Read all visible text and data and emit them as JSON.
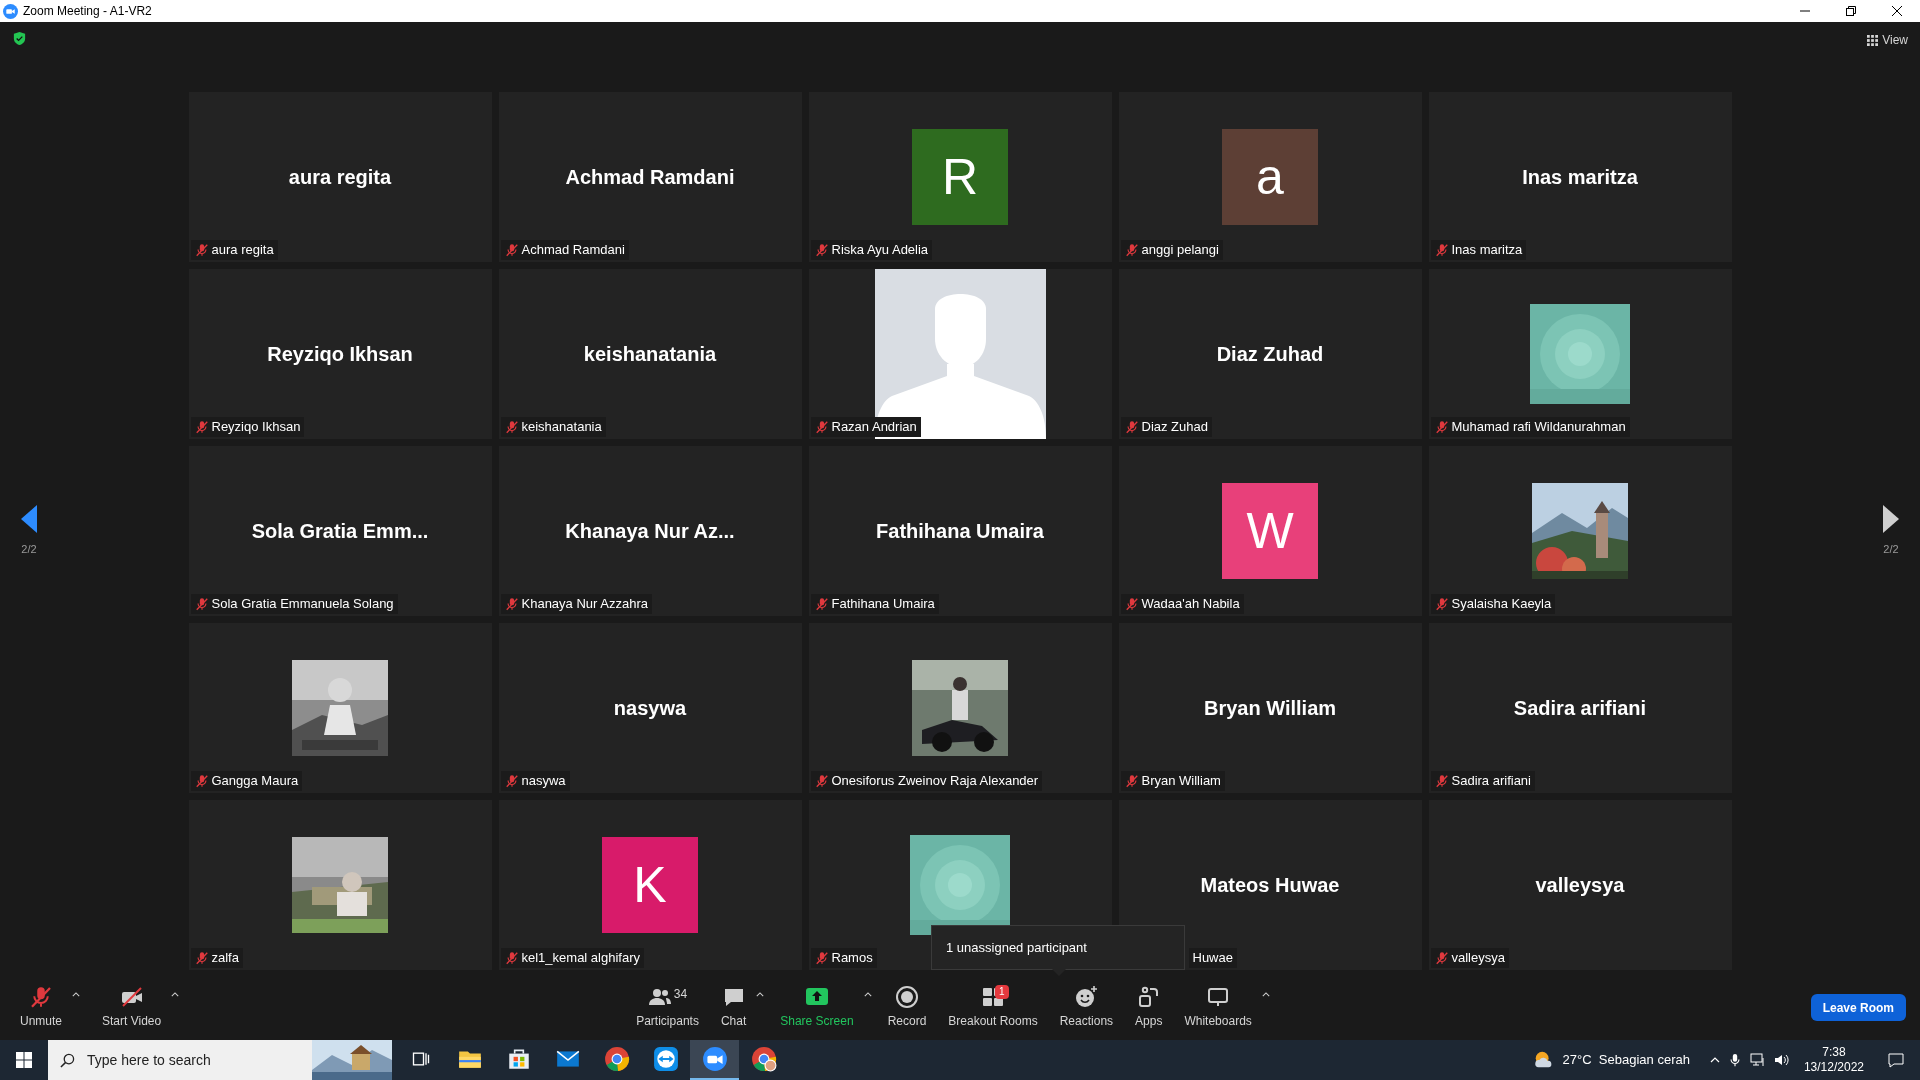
{
  "window": {
    "title": "Zoom Meeting - A1-VR2"
  },
  "view_button": {
    "label": "View"
  },
  "tiles": [
    {
      "kind": "name",
      "display_name": "aura regita",
      "label": "aura regita",
      "muted": true
    },
    {
      "kind": "name",
      "display_name": "Achmad Ramdani",
      "label": "Achmad Ramdani",
      "muted": true
    },
    {
      "kind": "letter",
      "letter": "R",
      "color": "#2e6b1f",
      "label": "Riska Ayu Adelia",
      "muted": true
    },
    {
      "kind": "letter",
      "letter": "a",
      "color": "#5d3f35",
      "label": "anggi pelangi",
      "muted": true
    },
    {
      "kind": "name",
      "display_name": "Inas maritza",
      "label": "Inas maritza",
      "muted": true
    },
    {
      "kind": "name",
      "display_name": "Reyziqo Ikhsan",
      "label": "Reyziqo Ikhsan",
      "muted": true
    },
    {
      "kind": "name",
      "display_name": "keishanatania",
      "label": "keishanatania",
      "muted": true
    },
    {
      "kind": "silhouette",
      "label": "Razan Andrian",
      "muted": true
    },
    {
      "kind": "name",
      "display_name": "Diaz Zuhad",
      "label": "Diaz Zuhad",
      "muted": true
    },
    {
      "kind": "picture",
      "label": "Muhamad rafi Wildanurahman",
      "muted": true
    },
    {
      "kind": "name",
      "display_name": "Sola Gratia Emm...",
      "label": "Sola Gratia Emmanuela Solang",
      "muted": true
    },
    {
      "kind": "name",
      "display_name": "Khanaya Nur Az...",
      "label": "Khanaya Nur Azzahra",
      "muted": true
    },
    {
      "kind": "name",
      "display_name": "Fathihana Umaira",
      "label": "Fathihana Umaira",
      "muted": true
    },
    {
      "kind": "letter",
      "letter": "W",
      "color": "#e8407a",
      "label": "Wadaa'ah Nabila",
      "muted": true
    },
    {
      "kind": "picture",
      "label": "Syalaisha Kaeyla",
      "muted": true
    },
    {
      "kind": "picture",
      "label": "Gangga Maura",
      "muted": true
    },
    {
      "kind": "name",
      "display_name": "nasywa",
      "label": "nasywa",
      "muted": true
    },
    {
      "kind": "picture",
      "label": "Onesiforus Zweinov Raja Alexander",
      "muted": true
    },
    {
      "kind": "name",
      "display_name": "Bryan William",
      "label": "Bryan William",
      "muted": true
    },
    {
      "kind": "name",
      "display_name": "Sadira arifiani",
      "label": "Sadira arifiani",
      "muted": true
    },
    {
      "kind": "picture",
      "label": "zalfa",
      "muted": true
    },
    {
      "kind": "letter",
      "letter": "K",
      "color": "#d81b6a",
      "label": "kel1_kemal alghifary",
      "muted": true
    },
    {
      "kind": "picture",
      "label": "Ramos",
      "muted": true
    },
    {
      "kind": "name",
      "display_name": "Mateos Huwae",
      "label": "Huwae",
      "covered": true
    },
    {
      "kind": "name",
      "display_name": "valleysya",
      "label": "valleysya",
      "muted": true
    }
  ],
  "pager": {
    "left": "2/2",
    "right": "2/2"
  },
  "tooltip": "1 unassigned participant",
  "toolbar_left": [
    {
      "kind": "mic",
      "label": "Unmute",
      "off": true,
      "has_menu": true
    },
    {
      "kind": "video",
      "label": "Start Video",
      "off": true,
      "has_menu": true
    }
  ],
  "toolbar_center": [
    {
      "kind": "participants",
      "label": "Participants",
      "count": "34",
      "has_menu": false
    },
    {
      "kind": "chat",
      "label": "Chat",
      "has_menu": true
    },
    {
      "kind": "share",
      "label": "Share Screen",
      "has_menu": true
    },
    {
      "kind": "record",
      "label": "Record",
      "has_menu": false
    },
    {
      "kind": "breakout",
      "label": "Breakout Rooms",
      "badge": "1",
      "has_menu": false
    },
    {
      "kind": "reactions",
      "label": "Reactions",
      "has_menu": false
    },
    {
      "kind": "apps",
      "label": "Apps",
      "has_menu": false
    },
    {
      "kind": "whiteboards",
      "label": "Whiteboards",
      "has_menu": true
    }
  ],
  "leave_button": "Leave Room",
  "taskbar": {
    "search_placeholder": "Type here to search",
    "apps": [
      {
        "kind": "taskview",
        "selected": false
      },
      {
        "kind": "explorer",
        "selected": false
      },
      {
        "kind": "store",
        "selected": false
      },
      {
        "kind": "mail",
        "selected": false
      },
      {
        "kind": "chrome",
        "selected": false
      },
      {
        "kind": "teamviewer",
        "selected": false
      },
      {
        "kind": "zoom",
        "selected": true
      },
      {
        "kind": "chrome-profile",
        "selected": false
      }
    ],
    "weather": "27°C  Sebagian cerah",
    "time": "7:38",
    "date": "13/12/2022"
  }
}
